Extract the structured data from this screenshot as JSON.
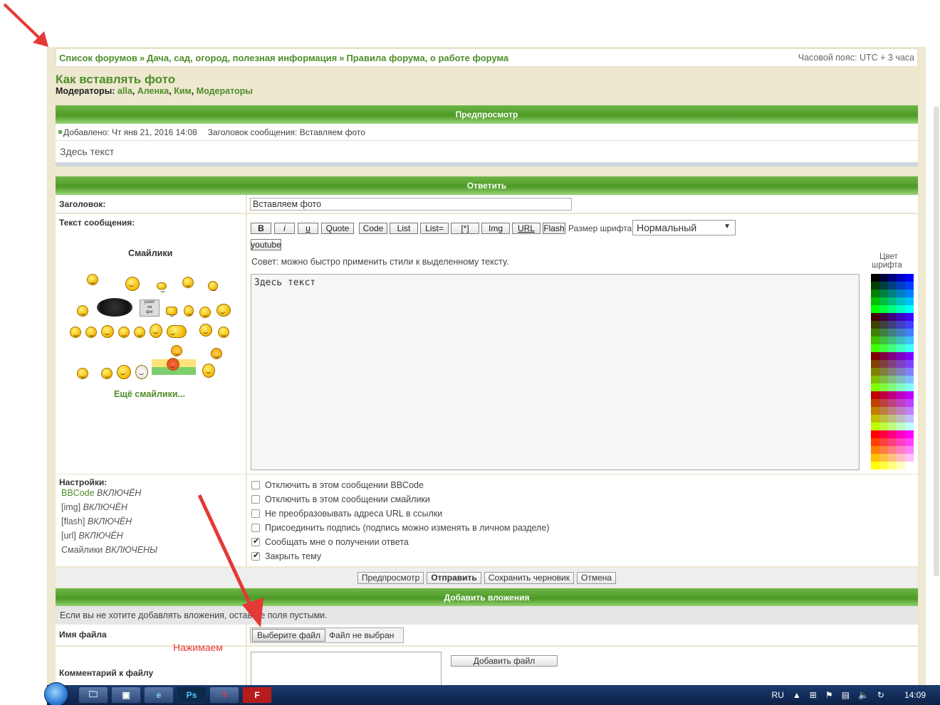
{
  "breadcrumb": {
    "items": [
      "Список форумов",
      "Дача, сад, огород, полезная информация",
      "Правила форума, о работе форума"
    ],
    "separator": "»",
    "timezone": "Часовой пояс: UTC + 3 часа"
  },
  "topic": {
    "title": "Как вставлять фото",
    "moderators_label": "Модераторы:",
    "moderators": [
      "alla",
      "Аленка",
      "Ким",
      "Модераторы"
    ]
  },
  "preview": {
    "header": "Предпросмотр",
    "meta_added": "Добавлено: Чт янв 21, 2016 14:08",
    "meta_subject": "Заголовок сообщения: Вставляем фото",
    "body": "Здесь текст"
  },
  "reply": {
    "header": "Ответить",
    "subject_label": "Заголовок:",
    "subject_value": "Вставляем фото",
    "message_label": "Текст сообщения:",
    "smileys_title": "Смайлики",
    "more_smileys": "Ещё смайлики...",
    "bbcode_buttons": [
      "B",
      "i",
      "u",
      "Quote",
      "Code",
      "List",
      "List=",
      "[*]",
      "Img",
      "URL",
      "Flash"
    ],
    "youtube_button": "youtube",
    "font_size_label": "Размер шрифта:",
    "font_size_value": "Нормальный",
    "tip": "Совет: можно быстро применить стили к выделенному тексту.",
    "message_value": "Здесь текст",
    "color_label_1": "Цвет",
    "color_label_2": "шрифта"
  },
  "settings": {
    "label": "Настройки:",
    "status": [
      {
        "name": "BBCode",
        "value": "ВКЛЮЧЁН"
      },
      {
        "name": "[img]",
        "value": "ВКЛЮЧЁН"
      },
      {
        "name": "[flash]",
        "value": "ВКЛЮЧЁН"
      },
      {
        "name": "[url]",
        "value": "ВКЛЮЧЁН"
      },
      {
        "name": "Смайлики",
        "value": "ВКЛЮЧЕНЫ"
      }
    ],
    "options": [
      {
        "label": "Отключить в этом сообщении BBCode",
        "checked": false
      },
      {
        "label": "Отключить в этом сообщении смайлики",
        "checked": false
      },
      {
        "label": "Не преобразовывать адреса URL в ссылки",
        "checked": false
      },
      {
        "label": "Присоединить подпись (подпись можно изменять в личном разделе)",
        "checked": false
      },
      {
        "label": "Сообщать мне о получении ответа",
        "checked": true
      },
      {
        "label": "Закрыть тему",
        "checked": true
      }
    ]
  },
  "actions": {
    "preview": "Предпросмотр",
    "submit": "Отправить",
    "save_draft": "Сохранить черновик",
    "cancel": "Отмена"
  },
  "attachments": {
    "header": "Добавить вложения",
    "hint": "Если вы не хотите добавлять вложения, оставьте поля пустыми.",
    "filename_label": "Имя файла",
    "choose_file": "Выберите файл",
    "no_file": "Файл не выбран",
    "comment_label": "Комментарий к файлу",
    "add_file": "Добавить файл"
  },
  "annotation": {
    "text": "Нажимаем",
    "color": "#e53935"
  },
  "taskbar": {
    "apps": [
      "explorer-icon",
      "control-panel-icon",
      "ie-icon",
      "photoshop-icon",
      "yandex-icon",
      "filezilla-icon"
    ],
    "ps_label": "Ps",
    "lang": "RU",
    "time": "14:09"
  },
  "colors": {
    "accent_green": "#4f8d2a",
    "page_bg": "#ede8cf",
    "annotation_red": "#e53935"
  }
}
